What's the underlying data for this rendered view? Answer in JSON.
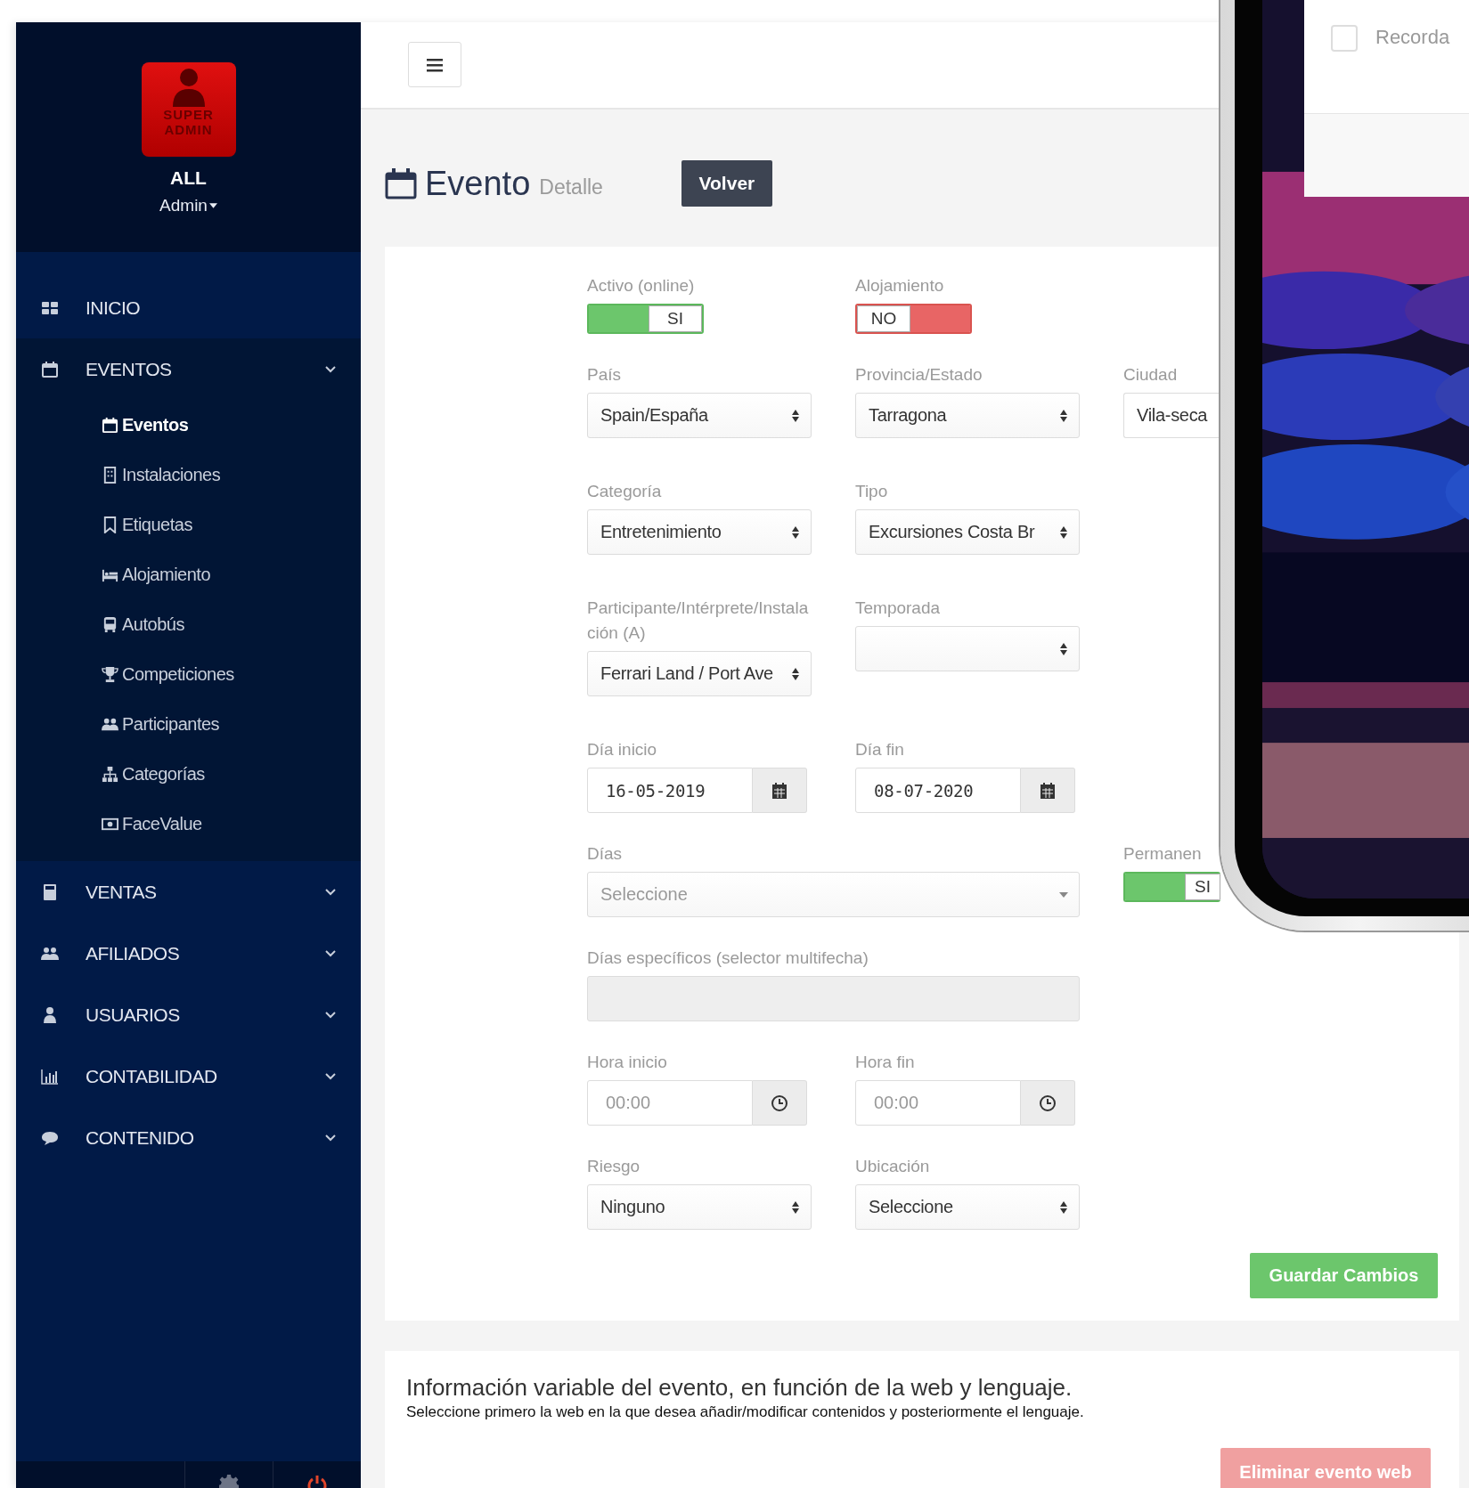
{
  "sidebar": {
    "badge_lines": [
      "SUPER",
      "ADMIN"
    ],
    "account": "ALL",
    "user": "Admin",
    "menu": [
      {
        "label": "INICIO"
      },
      {
        "label": "EVENTOS",
        "children": [
          {
            "label": "Eventos",
            "selected": true
          },
          {
            "label": "Instalaciones",
            "selected": false
          },
          {
            "label": "Etiquetas",
            "selected": false
          },
          {
            "label": "Alojamiento",
            "selected": false
          },
          {
            "label": "Autobús",
            "selected": false
          },
          {
            "label": "Competiciones",
            "selected": false
          },
          {
            "label": "Participantes",
            "selected": false
          },
          {
            "label": "Categorías",
            "selected": false
          },
          {
            "label": "FaceValue",
            "selected": false
          }
        ]
      },
      {
        "label": "VENTAS"
      },
      {
        "label": "AFILIADOS"
      },
      {
        "label": "USUARIOS"
      },
      {
        "label": "CONTABILIDAD"
      },
      {
        "label": "CONTENIDO"
      }
    ]
  },
  "header": {
    "title": "Evento",
    "subtitle": "Detalle",
    "back_button": "Volver"
  },
  "form": {
    "rows": [
      {
        "fields": [
          {
            "kind": "toggle",
            "label": "Activo (online)",
            "on": true,
            "text": "SI"
          },
          {
            "kind": "toggle",
            "label": "Alojamiento",
            "on": false,
            "text": "NO"
          }
        ]
      },
      {
        "fields": [
          {
            "kind": "select",
            "label": "País",
            "value": "Spain/España"
          },
          {
            "kind": "select",
            "label": "Provincia/Estado",
            "value": "Tarragona"
          },
          {
            "kind": "input",
            "label": "Ciudad",
            "value": "Vila-seca"
          }
        ]
      },
      {
        "fields": [
          {
            "kind": "select",
            "label": "Categoría",
            "value": "Entretenimiento"
          },
          {
            "kind": "select",
            "label": "Tipo",
            "value": "Excursiones Costa Br"
          }
        ]
      },
      {
        "fields": [
          {
            "kind": "select",
            "label": "Participante/Intérprete/Instalación (A)",
            "value": "Ferrari Land / Port Ave"
          },
          {
            "kind": "select",
            "label": "Temporada"
          }
        ]
      },
      {
        "fields": [
          {
            "kind": "date",
            "label": "Día inicio",
            "value": "16-05-2019"
          },
          {
            "kind": "date",
            "label": "Día fin",
            "value": "08-07-2020"
          }
        ]
      },
      {
        "fields": [
          {
            "kind": "dropdown",
            "label": "Días",
            "placeholder": "Seleccione"
          },
          {
            "kind": "toggle",
            "label": "Permanen",
            "on": true,
            "text": "SI"
          }
        ]
      },
      {
        "fields": [
          {
            "kind": "input",
            "label": "Días específicos (selector multifecha)",
            "disabled": true
          }
        ]
      },
      {
        "fields": [
          {
            "kind": "time",
            "label": "Hora inicio",
            "placeholder": "00:00"
          },
          {
            "kind": "time",
            "label": "Hora fin",
            "placeholder": "00:00"
          }
        ]
      },
      {
        "fields": [
          {
            "kind": "select",
            "label": "Riesgo",
            "value": "Ninguno"
          },
          {
            "kind": "select",
            "label": "Ubicación",
            "value": "Seleccione"
          }
        ]
      }
    ],
    "save_button": "Guardar Cambios"
  },
  "web_info": {
    "title": "Información variable del evento, en función de la web y lenguaje.",
    "note": "Seleccione primero la web en la que desea añadir/modificar contenidos y posteriormente el lenguaje.",
    "delete_button": "Eliminar evento web"
  },
  "phone": {
    "checkbox": {
      "label": "Recorda",
      "checked": false
    }
  }
}
